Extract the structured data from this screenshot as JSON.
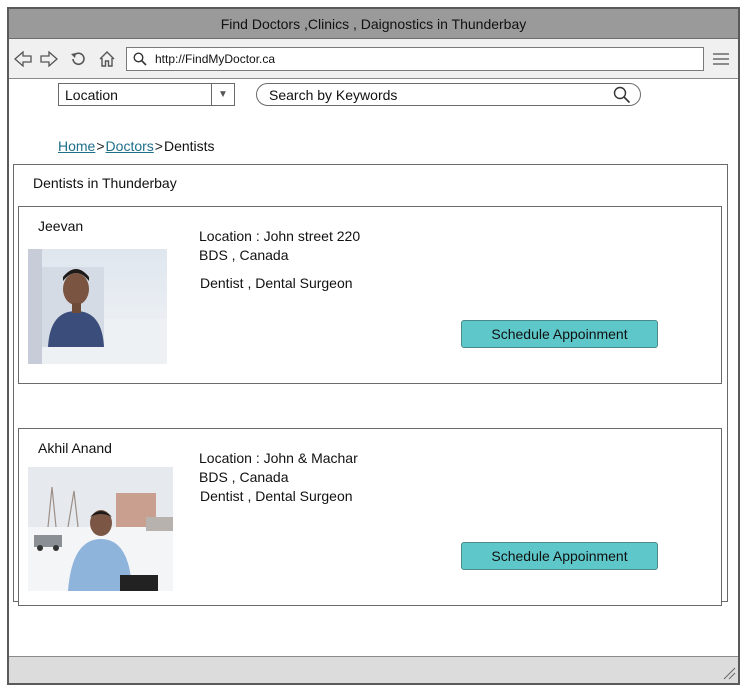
{
  "window": {
    "title": "Find Doctors ,Clinics , Daignostics in Thunderbay"
  },
  "browser": {
    "url": "http://FindMyDoctor.ca"
  },
  "filters": {
    "location_value": "Location",
    "search_placeholder": "Search by Keywords"
  },
  "breadcrumb": {
    "home": "Home",
    "doctors": "Doctors",
    "current": "Dentists",
    "separator": ">"
  },
  "panel": {
    "title": "Dentists in Thunderbay"
  },
  "doctors": [
    {
      "name": "Jeevan",
      "location": "Location : John street 220",
      "degree": "BDS , Canada",
      "specialty": "Dentist , Dental Surgeon",
      "button": "Schedule Appoinment"
    },
    {
      "name": "Akhil Anand",
      "location": "Location : John & Machar",
      "degree": "BDS , Canada",
      "specialty": "Dentist , Dental Surgeon",
      "button": "Schedule Appoinment"
    }
  ],
  "icons": {
    "back": "back-arrow-icon",
    "forward": "forward-arrow-icon",
    "reload": "reload-icon",
    "home": "home-icon",
    "search": "search-icon",
    "menu": "hamburger-menu-icon",
    "dropdown": "chevron-down-icon",
    "resize": "resize-grip-icon"
  },
  "colors": {
    "titlebar": "#9a9a9a",
    "button": "#5ec7c9",
    "link": "#1f6f8b"
  }
}
